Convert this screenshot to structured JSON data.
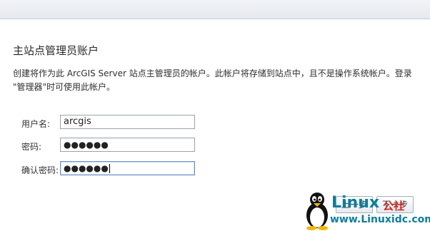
{
  "page": {
    "title": "主站点管理员账户",
    "description_line1": "创建将作为此 ArcGIS Server 站点主管理员的帐户。此帐户将存储到站点中，且不是操作系统帐户。登录",
    "description_line2": "\"管理器\"时可使用此帐户。"
  },
  "form": {
    "username_label": "用户名:",
    "username_value": "arcgis",
    "password_label": "密码:",
    "password_value": "●●●●●●",
    "confirm_label": "确认密码:",
    "confirm_value": "●●●●●●"
  },
  "buttons": {
    "prev": "上一步",
    "next": "下一步"
  },
  "watermark": {
    "brand": "Linux",
    "suffix": "公社",
    "url": "www.Linuxidc.com"
  }
}
